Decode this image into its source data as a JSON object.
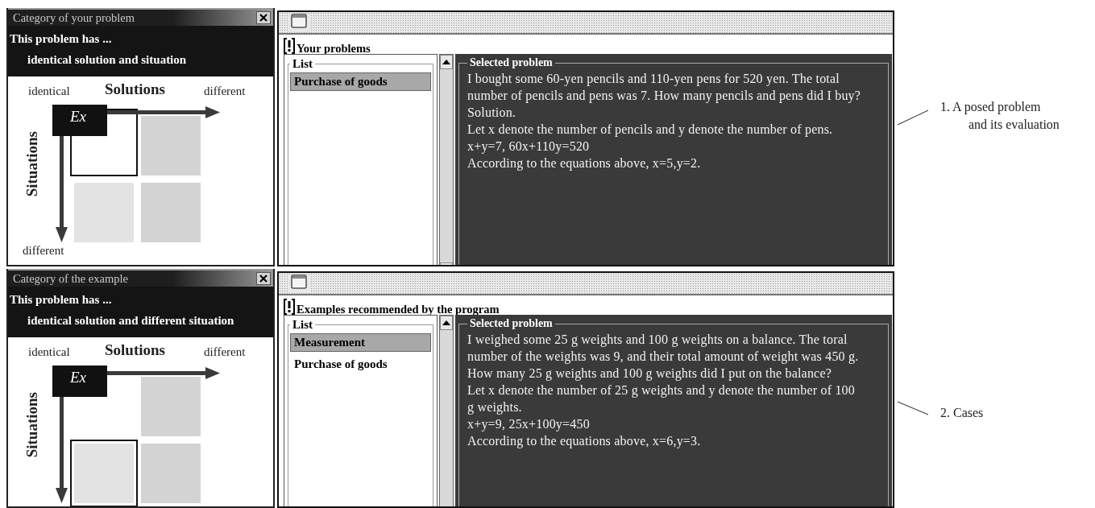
{
  "sections": [
    {
      "category": {
        "title": "Category of your problem",
        "header": "This problem has ...",
        "category_text": "identical solution and situation",
        "x_axis": {
          "title": "Solutions",
          "start": "identical",
          "end": "different"
        },
        "y_axis": {
          "title": "Situations",
          "end": "different"
        },
        "marker": "Ex",
        "cells": [
          {
            "kind": "origin",
            "selected": true
          },
          {
            "kind": "across",
            "selected": false
          },
          {
            "kind": "down",
            "selected": false
          },
          {
            "kind": "diagonal",
            "selected": false
          }
        ]
      },
      "problems": {
        "heading": "Your problems",
        "list_title": "List",
        "items": [
          {
            "label": "Purchase of goods",
            "selected": true
          }
        ],
        "detail_title": "Selected problem",
        "detail_paragraphs": [
          "I bought some 60-yen pencils and 110-yen pens for 520 yen. The total number of pencils and pens was 7. How many pencils and pens did I buy?",
          "Solution.",
          "Let x denote the number of pencils and y denote the number of pens.",
          "x+y=7, 60x+110y=520",
          "According to the equations above, x=5,y=2."
        ]
      },
      "annotation": [
        "1. A posed problem",
        "and its evaluation"
      ]
    },
    {
      "category": {
        "title": "Category of the example",
        "header": "This problem has ...",
        "category_text": "identical solution and different situation",
        "x_axis": {
          "title": "Solutions",
          "start": "identical",
          "end": "different"
        },
        "y_axis": {
          "title": "Situations"
        },
        "marker": "Ex",
        "cells": [
          {
            "kind": "across",
            "selected": false
          },
          {
            "kind": "down",
            "selected": true
          },
          {
            "kind": "diagonal",
            "selected": false
          }
        ]
      },
      "problems": {
        "heading": "Examples recommended by the program",
        "list_title": "List",
        "items": [
          {
            "label": "Measurement",
            "selected": true
          },
          {
            "label": "Purchase of goods",
            "selected": false
          }
        ],
        "detail_title": "Selected problem",
        "detail_paragraphs": [
          "I weighed some 25 g weights and 100 g weights on a balance. The toral number of the weights was 9, and their total amount of weight was 450 g. How many 25 g weights and 100 g weights did I put on the balance?",
          "Let x denote the number of 25 g weights and y denote the number of 100 g weights.",
          "x+y=9, 25x+100y=450",
          "According to the equations above, x=6,y=3."
        ]
      },
      "annotation": [
        "2. Cases"
      ]
    }
  ]
}
